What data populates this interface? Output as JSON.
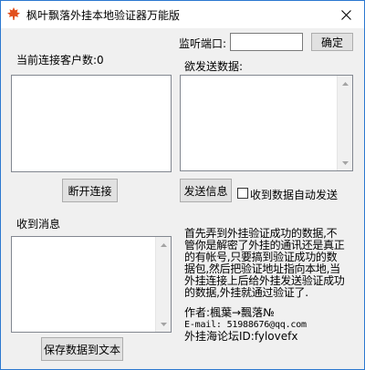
{
  "window": {
    "title": "枫叶飘落外挂本地验证器万能版"
  },
  "listen": {
    "label": "监听端口:",
    "value": "",
    "confirm_label": "确定"
  },
  "clients": {
    "label": "当前连接客户数:0",
    "disconnect_label": "断开连接"
  },
  "send": {
    "label": "欲发送数据:",
    "send_button": "发送信息",
    "auto_send_label": "收到数据自动发送",
    "auto_send_checked": false
  },
  "received": {
    "label": "收到消息",
    "save_button": "保存数据到文本"
  },
  "info": {
    "lines": [
      "首先弄到外挂验证成功的数据,不",
      "管你是解密了外挂的通讯还是真正",
      "的有帐号,只要搞到验证成功的数",
      "据包,然后把验证地址指向本地,当",
      "外挂连接上后给外挂发送验证成功",
      "的数据,外挂就通过验证了."
    ]
  },
  "credits": {
    "author": "作者:楓葉→飄落№",
    "email": "E-mail: 51988676@qq.com",
    "forum": "外挂海论坛ID:fylovefx"
  }
}
